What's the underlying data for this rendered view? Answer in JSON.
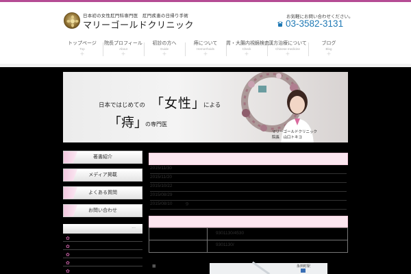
{
  "header": {
    "tagline": "日本初の女性肛門科専門医　肛門疾患の日帰り手術",
    "clinic_name": "マリーゴールドクリニック",
    "contact_note": "お気軽にお問い合わせください。",
    "phone": "03-3582-3131"
  },
  "nav": {
    "items": [
      {
        "label": "トップページ",
        "sub": "Top"
      },
      {
        "label": "院長プロフィール",
        "sub": "About"
      },
      {
        "label": "初診の方へ",
        "sub": "Guide"
      },
      {
        "label": "痔について",
        "sub": "Hemorrhoids"
      },
      {
        "label": "胃・大腸内視鏡検査",
        "sub": "Check"
      },
      {
        "label": "漢方治療について",
        "sub": "Chinese medicine"
      },
      {
        "label": "ブログ",
        "sub": "Blog"
      }
    ]
  },
  "hero": {
    "line1_prefix": "日本ではじめての",
    "line1_big": "「女性」",
    "line1_suffix": "による",
    "line2_big": "「痔」",
    "line2_suffix": "の専門医",
    "caption_clinic": "マリーゴールドクリニック",
    "caption_name": "院長　山口トキコ"
  },
  "sidebar": {
    "buttons": [
      "著書紹介",
      "メディア掲載",
      "よくある質問",
      "お問い合わせ"
    ],
    "more": "..."
  },
  "news": {
    "items": [
      {
        "date": "2015/11/30",
        "text": ""
      },
      {
        "date": "2015/11/20",
        "text": ""
      },
      {
        "date": "2015/10/22",
        "text": ""
      },
      {
        "date": "2015/08/29",
        "text": ""
      },
      {
        "date": "2015/08/10",
        "text": "9"
      }
    ]
  },
  "info": {
    "row1": "9301130/4530",
    "row2": "9301130/"
  },
  "map": {
    "label": "永田町駅"
  }
}
